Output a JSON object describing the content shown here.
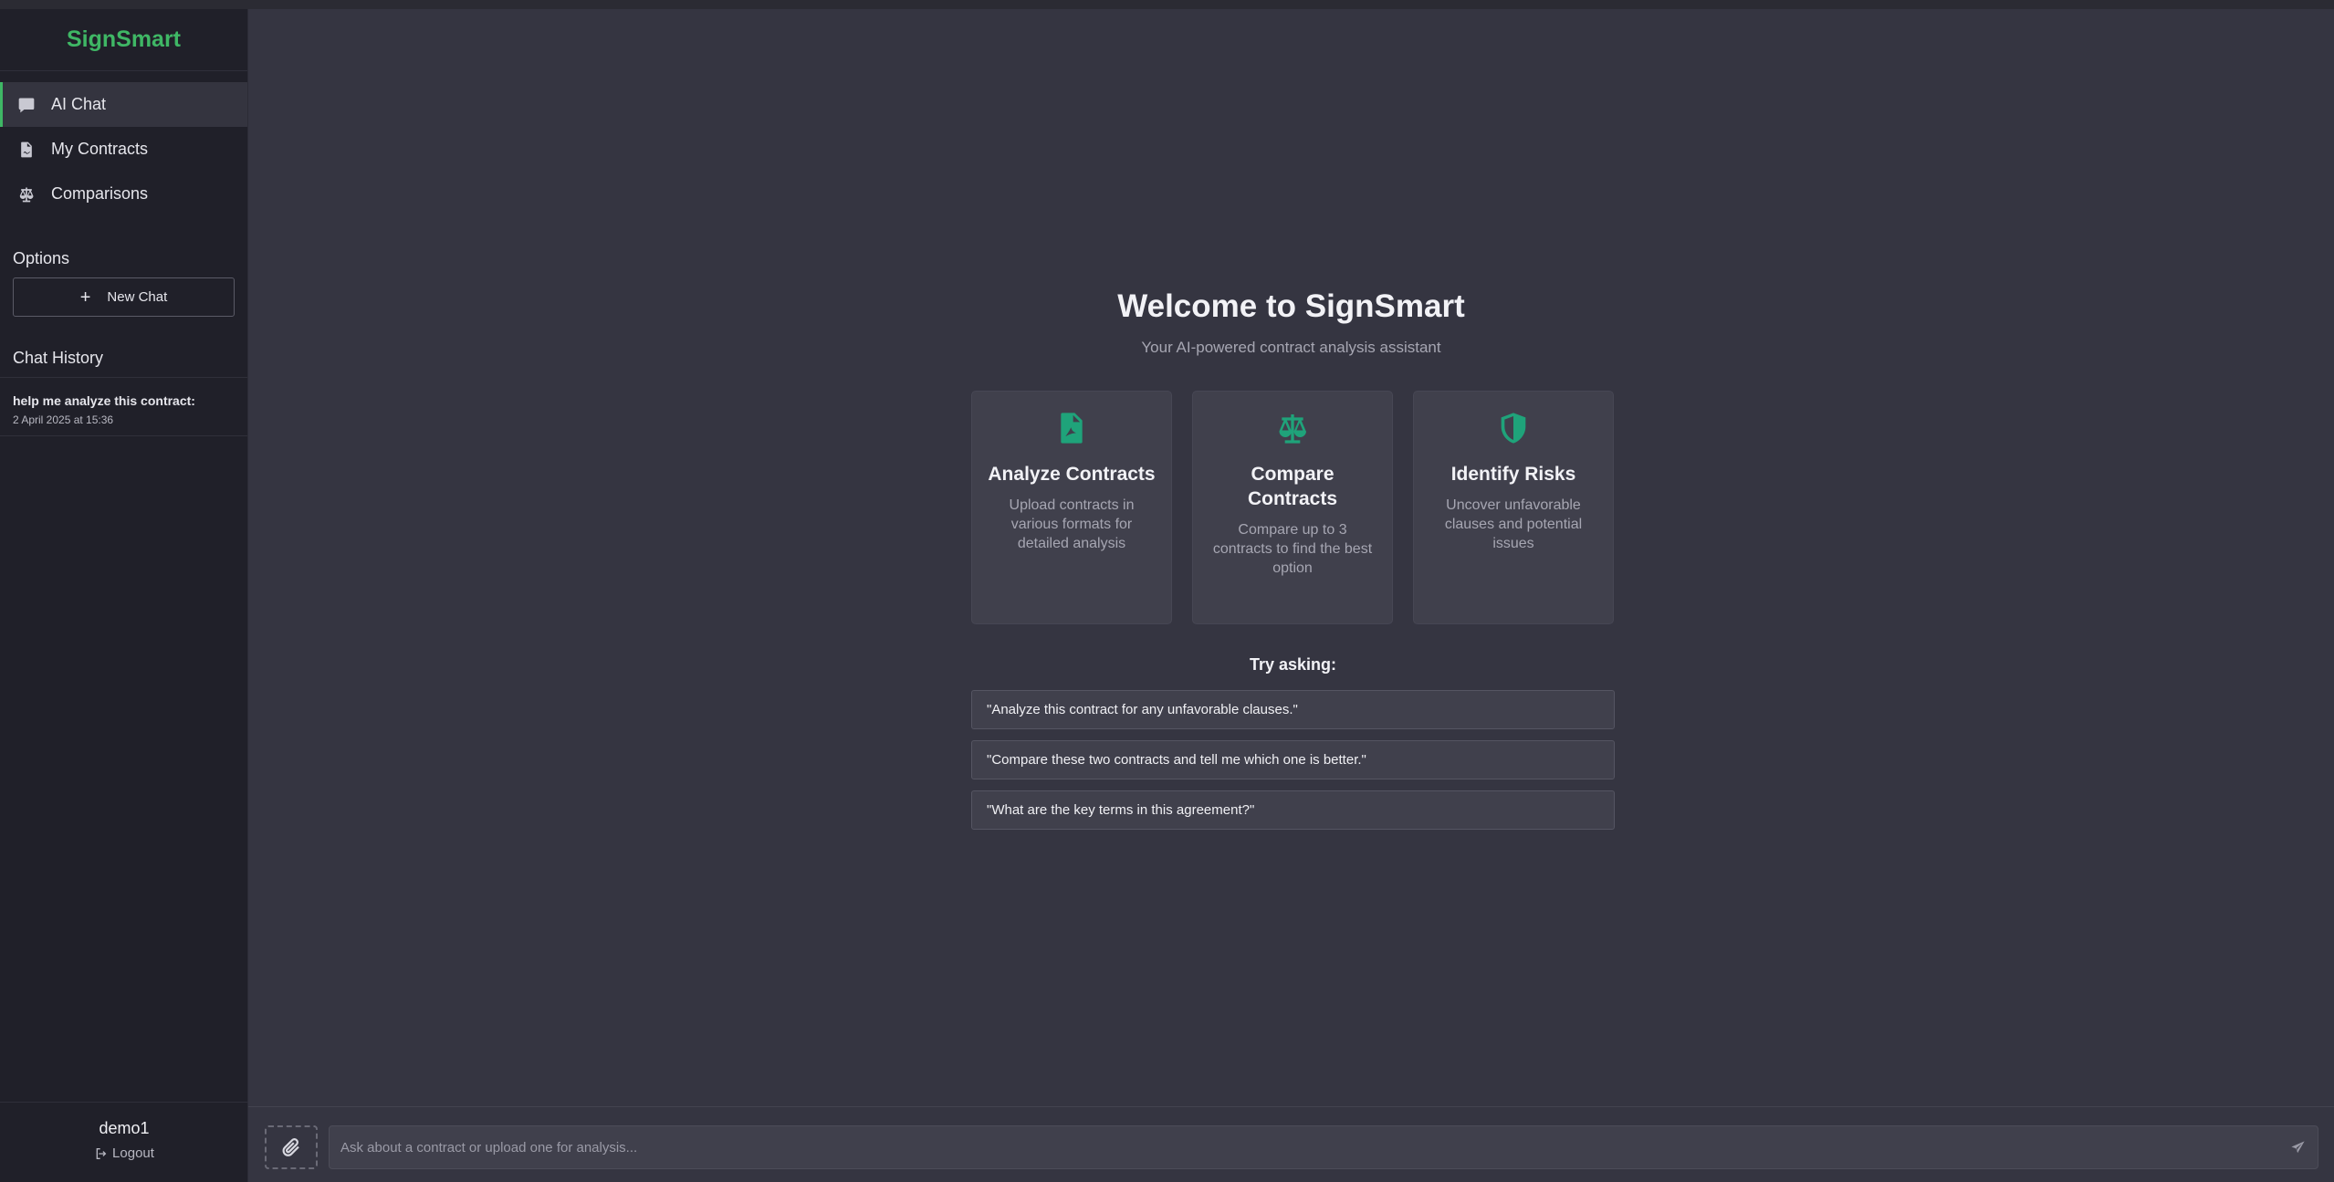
{
  "app": {
    "brand": "SignSmart",
    "brand_color": "#3fb765",
    "accent_color": "#1fa37a"
  },
  "sidebar": {
    "nav": [
      {
        "label": "AI Chat",
        "icon": "chat-bubble-icon",
        "active": true
      },
      {
        "label": "My Contracts",
        "icon": "file-contract-icon",
        "active": false
      },
      {
        "label": "Comparisons",
        "icon": "scale-icon",
        "active": false
      }
    ],
    "options_title": "Options",
    "new_chat_label": "New Chat",
    "history_title": "Chat History",
    "history": [
      {
        "title": "help me analyze this contract:",
        "date": "2 April 2025 at 15:36"
      }
    ],
    "user": {
      "name": "demo1",
      "logout_label": "Logout"
    }
  },
  "main": {
    "welcome_title": "Welcome to SignSmart",
    "welcome_subtitle": "Your AI-powered contract analysis assistant",
    "features": [
      {
        "icon": "file-pdf-icon",
        "title": "Analyze Contracts",
        "desc": "Upload contracts in various formats for detailed analysis"
      },
      {
        "icon": "scale-icon",
        "title": "Compare Contracts",
        "desc": "Compare up to 3 contracts to find the best option"
      },
      {
        "icon": "shield-icon",
        "title": "Identify Risks",
        "desc": "Uncover unfavorable clauses and potential issues"
      }
    ],
    "try_title": "Try asking:",
    "prompts": [
      "\"Analyze this contract for any unfavorable clauses.\"",
      "\"Compare these two contracts and tell me which one is better.\"",
      "\"What are the key terms in this agreement?\""
    ]
  },
  "input": {
    "placeholder": "Ask about a contract or upload one for analysis...",
    "attach_icon": "paperclip-icon",
    "send_icon": "send-icon"
  }
}
